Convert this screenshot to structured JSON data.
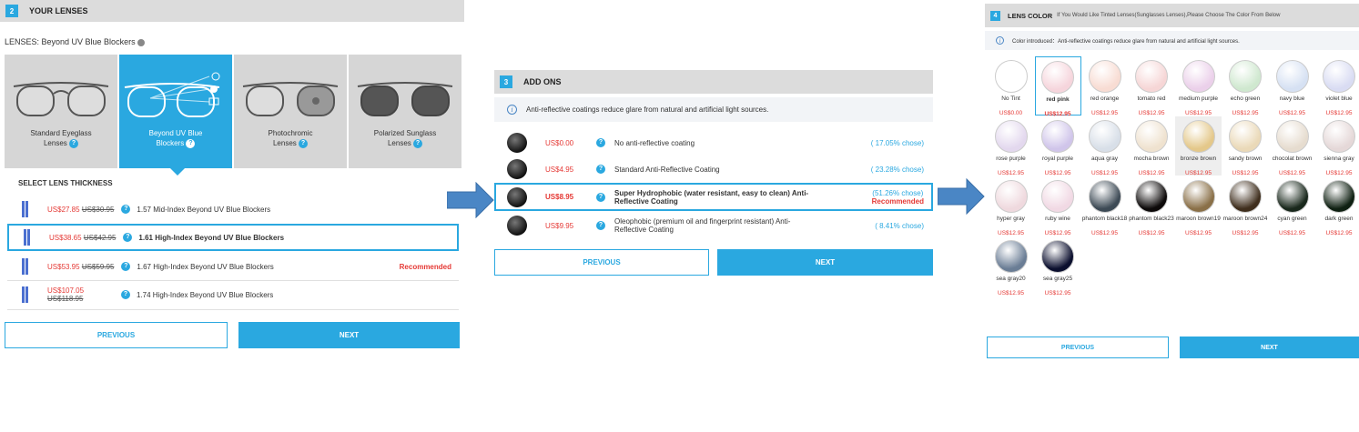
{
  "colors": {
    "accent": "#2aa8e0",
    "price": "#e53935",
    "card": "#d6d6d6"
  },
  "lenses": {
    "step": "2",
    "title": "YOUR LENSES",
    "lens_label": "LENSES: Beyond UV Blue Blockers",
    "cards": [
      {
        "label1": "Standard Eyeglass",
        "label2": "Lenses"
      },
      {
        "label1": "Beyond UV Blue",
        "label2": "Blockers"
      },
      {
        "label1": "Photochromic",
        "label2": "Lenses"
      },
      {
        "label1": "Polarized Sunglass",
        "label2": "Lenses"
      }
    ],
    "thickness_title": "SELECT LENS THICKNESS",
    "options": [
      {
        "price": "US$27.85",
        "old": "US$30.95",
        "name": "1.57 Mid-Index Beyond UV Blue Blockers",
        "tag": ""
      },
      {
        "price": "US$38.65",
        "old": "US$42.95",
        "name": "1.61 High-Index Beyond UV Blue Blockers",
        "tag": ""
      },
      {
        "price": "US$53.95",
        "old": "US$59.95",
        "name": "1.67 High-Index Beyond UV Blue Blockers",
        "tag": "Recommended"
      },
      {
        "price": "US$107.05",
        "old": "US$118.95",
        "name": "1.74 High-Index Beyond UV Blue Blockers",
        "tag": ""
      }
    ],
    "prev": "PREVIOUS",
    "next": "NEXT"
  },
  "addons": {
    "step": "3",
    "title": "ADD ONS",
    "info": "Anti-reflective coatings reduce glare from natural and artificial light sources.",
    "options": [
      {
        "price": "US$0.00",
        "name": "No anti-reflective coating",
        "name2": "",
        "pct": "( 17.05% chose)",
        "tag": ""
      },
      {
        "price": "US$4.95",
        "name": "Standard Anti-Reflective Coating",
        "name2": "",
        "pct": "( 23.28% chose)",
        "tag": ""
      },
      {
        "price": "US$8.95",
        "name": "Super Hydrophobic (water resistant, easy to clean) Anti-",
        "name2": "Reflective Coating",
        "pct": "(51.26% chose)",
        "tag": "Recommended"
      },
      {
        "price": "US$9.95",
        "name": "Oleophobic (premium oil and fingerprint resistant) Anti-",
        "name2": "Reflective Coating",
        "pct": "( 8.41% chose)",
        "tag": ""
      }
    ],
    "prev": "PREVIOUS",
    "next": "NEXT"
  },
  "color": {
    "step": "4",
    "title": "LENS COLOR",
    "subtitle": "If You Would Like Tinted Lenses(Sunglasses Lenses),Please Choose The Color From Below",
    "info": "Color introduced：Anti-reflective coatings reduce glare from natural and artificial light sources.",
    "swatches": [
      {
        "name": "No Tint",
        "price": "US$0.00",
        "color": "#ffffff"
      },
      {
        "name": "red pink",
        "price": "US$12.95",
        "color": "#f6d5dc"
      },
      {
        "name": "red orange",
        "price": "US$12.95",
        "color": "#f8dcd3"
      },
      {
        "name": "tomato red",
        "price": "US$12.95",
        "color": "#f6d6d6"
      },
      {
        "name": "medium purple",
        "price": "US$12.95",
        "color": "#ebd0ea"
      },
      {
        "name": "echo green",
        "price": "US$12.95",
        "color": "#cfe8cf"
      },
      {
        "name": "navy blue",
        "price": "US$12.95",
        "color": "#d6e1f3"
      },
      {
        "name": "violet blue",
        "price": "US$12.95",
        "color": "#d9dcf3"
      },
      {
        "name": "rose purple",
        "price": "US$12.95",
        "color": "#e3d8ee"
      },
      {
        "name": "royal purple",
        "price": "US$12.95",
        "color": "#d0c5ea"
      },
      {
        "name": "aqua gray",
        "price": "US$12.95",
        "color": "#d8dfe8"
      },
      {
        "name": "mocha brown",
        "price": "US$12.95",
        "color": "#efe2cf"
      },
      {
        "name": "bronze brown",
        "price": "US$12.95",
        "color": "#e4c88a"
      },
      {
        "name": "sandy brown",
        "price": "US$12.95",
        "color": "#ead9b8"
      },
      {
        "name": "chocolat brown",
        "price": "US$12.95",
        "color": "#e6dccf"
      },
      {
        "name": "sienna gray",
        "price": "US$12.95",
        "color": "#e5d8d8"
      },
      {
        "name": "hyper gray",
        "price": "US$12.95",
        "color": "#efd9de"
      },
      {
        "name": "ruby wine",
        "price": "US$12.95",
        "color": "#f1d9e4"
      },
      {
        "name": "phantom black18",
        "price": "US$12.95",
        "color": "#3d4a55"
      },
      {
        "name": "phantom black23",
        "price": "US$12.95",
        "color": "#0d0a0a"
      },
      {
        "name": "maroon brown19",
        "price": "US$12.95",
        "color": "#8a7048"
      },
      {
        "name": "maroon brown24",
        "price": "US$12.95",
        "color": "#3f2e1d"
      },
      {
        "name": "cyan green",
        "price": "US$12.95",
        "color": "#19281c"
      },
      {
        "name": "dark green",
        "price": "US$12.95",
        "color": "#0f2012"
      },
      {
        "name": "sea gray20",
        "price": "US$12.95",
        "color": "#6a7d95"
      },
      {
        "name": "sea gray25",
        "price": "US$12.95",
        "color": "#0b0f2e"
      }
    ],
    "prev": "PREVIOUS",
    "next": "NEXT"
  }
}
